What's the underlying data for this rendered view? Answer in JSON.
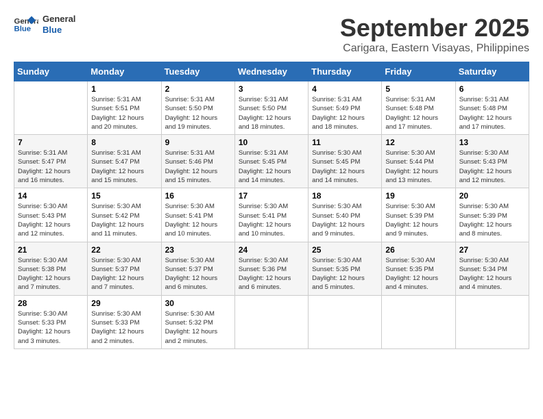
{
  "header": {
    "logo_line1": "General",
    "logo_line2": "Blue",
    "month_year": "September 2025",
    "location": "Carigara, Eastern Visayas, Philippines"
  },
  "days_of_week": [
    "Sunday",
    "Monday",
    "Tuesday",
    "Wednesday",
    "Thursday",
    "Friday",
    "Saturday"
  ],
  "weeks": [
    [
      {
        "day": "",
        "info": ""
      },
      {
        "day": "1",
        "info": "Sunrise: 5:31 AM\nSunset: 5:51 PM\nDaylight: 12 hours\nand 20 minutes."
      },
      {
        "day": "2",
        "info": "Sunrise: 5:31 AM\nSunset: 5:50 PM\nDaylight: 12 hours\nand 19 minutes."
      },
      {
        "day": "3",
        "info": "Sunrise: 5:31 AM\nSunset: 5:50 PM\nDaylight: 12 hours\nand 18 minutes."
      },
      {
        "day": "4",
        "info": "Sunrise: 5:31 AM\nSunset: 5:49 PM\nDaylight: 12 hours\nand 18 minutes."
      },
      {
        "day": "5",
        "info": "Sunrise: 5:31 AM\nSunset: 5:48 PM\nDaylight: 12 hours\nand 17 minutes."
      },
      {
        "day": "6",
        "info": "Sunrise: 5:31 AM\nSunset: 5:48 PM\nDaylight: 12 hours\nand 17 minutes."
      }
    ],
    [
      {
        "day": "7",
        "info": "Sunrise: 5:31 AM\nSunset: 5:47 PM\nDaylight: 12 hours\nand 16 minutes."
      },
      {
        "day": "8",
        "info": "Sunrise: 5:31 AM\nSunset: 5:47 PM\nDaylight: 12 hours\nand 15 minutes."
      },
      {
        "day": "9",
        "info": "Sunrise: 5:31 AM\nSunset: 5:46 PM\nDaylight: 12 hours\nand 15 minutes."
      },
      {
        "day": "10",
        "info": "Sunrise: 5:31 AM\nSunset: 5:45 PM\nDaylight: 12 hours\nand 14 minutes."
      },
      {
        "day": "11",
        "info": "Sunrise: 5:30 AM\nSunset: 5:45 PM\nDaylight: 12 hours\nand 14 minutes."
      },
      {
        "day": "12",
        "info": "Sunrise: 5:30 AM\nSunset: 5:44 PM\nDaylight: 12 hours\nand 13 minutes."
      },
      {
        "day": "13",
        "info": "Sunrise: 5:30 AM\nSunset: 5:43 PM\nDaylight: 12 hours\nand 12 minutes."
      }
    ],
    [
      {
        "day": "14",
        "info": "Sunrise: 5:30 AM\nSunset: 5:43 PM\nDaylight: 12 hours\nand 12 minutes."
      },
      {
        "day": "15",
        "info": "Sunrise: 5:30 AM\nSunset: 5:42 PM\nDaylight: 12 hours\nand 11 minutes."
      },
      {
        "day": "16",
        "info": "Sunrise: 5:30 AM\nSunset: 5:41 PM\nDaylight: 12 hours\nand 10 minutes."
      },
      {
        "day": "17",
        "info": "Sunrise: 5:30 AM\nSunset: 5:41 PM\nDaylight: 12 hours\nand 10 minutes."
      },
      {
        "day": "18",
        "info": "Sunrise: 5:30 AM\nSunset: 5:40 PM\nDaylight: 12 hours\nand 9 minutes."
      },
      {
        "day": "19",
        "info": "Sunrise: 5:30 AM\nSunset: 5:39 PM\nDaylight: 12 hours\nand 9 minutes."
      },
      {
        "day": "20",
        "info": "Sunrise: 5:30 AM\nSunset: 5:39 PM\nDaylight: 12 hours\nand 8 minutes."
      }
    ],
    [
      {
        "day": "21",
        "info": "Sunrise: 5:30 AM\nSunset: 5:38 PM\nDaylight: 12 hours\nand 7 minutes."
      },
      {
        "day": "22",
        "info": "Sunrise: 5:30 AM\nSunset: 5:37 PM\nDaylight: 12 hours\nand 7 minutes."
      },
      {
        "day": "23",
        "info": "Sunrise: 5:30 AM\nSunset: 5:37 PM\nDaylight: 12 hours\nand 6 minutes."
      },
      {
        "day": "24",
        "info": "Sunrise: 5:30 AM\nSunset: 5:36 PM\nDaylight: 12 hours\nand 6 minutes."
      },
      {
        "day": "25",
        "info": "Sunrise: 5:30 AM\nSunset: 5:35 PM\nDaylight: 12 hours\nand 5 minutes."
      },
      {
        "day": "26",
        "info": "Sunrise: 5:30 AM\nSunset: 5:35 PM\nDaylight: 12 hours\nand 4 minutes."
      },
      {
        "day": "27",
        "info": "Sunrise: 5:30 AM\nSunset: 5:34 PM\nDaylight: 12 hours\nand 4 minutes."
      }
    ],
    [
      {
        "day": "28",
        "info": "Sunrise: 5:30 AM\nSunset: 5:33 PM\nDaylight: 12 hours\nand 3 minutes."
      },
      {
        "day": "29",
        "info": "Sunrise: 5:30 AM\nSunset: 5:33 PM\nDaylight: 12 hours\nand 2 minutes."
      },
      {
        "day": "30",
        "info": "Sunrise: 5:30 AM\nSunset: 5:32 PM\nDaylight: 12 hours\nand 2 minutes."
      },
      {
        "day": "",
        "info": ""
      },
      {
        "day": "",
        "info": ""
      },
      {
        "day": "",
        "info": ""
      },
      {
        "day": "",
        "info": ""
      }
    ]
  ]
}
